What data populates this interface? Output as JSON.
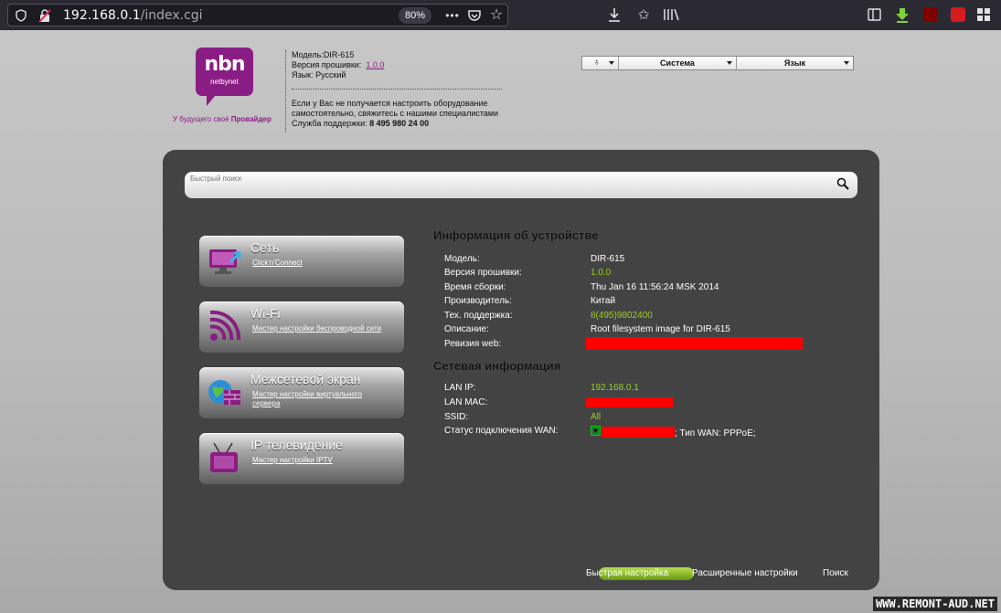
{
  "browser": {
    "url_host": "192.168.0.1",
    "url_path": "/index.cgi",
    "zoom": "80%"
  },
  "header": {
    "logo_top": "nbn",
    "logo_bottom": "netbynet",
    "slogan_prefix": "У будущего своё",
    "slogan_bold": "Провайдер",
    "model_label": "Модель:",
    "model_value": "DIR-615",
    "firmware_label": "Версия прошивки:",
    "firmware_value": "1.0.0",
    "language_label": "Язык:",
    "language_value": "Русский",
    "support_text_1": "Если у Вас не получается настроить оборудование",
    "support_text_2": "самостоятельно, свяжитесь с нашими специалистами",
    "support_label": "Служба поддержки:",
    "support_phone": "8 495 980 24 00"
  },
  "topmenu": {
    "system": "Система",
    "language": "Язык"
  },
  "search": {
    "placeholder": "Быстрый поиск"
  },
  "cards": [
    {
      "title": "Сеть",
      "subtitle": "Click'n'Connect"
    },
    {
      "title": "Wi-Fi",
      "subtitle": "Мастер настройки беспроводной сети"
    },
    {
      "title": "Межсетевой экран",
      "subtitle": "Мастер настройки виртуального сервера"
    },
    {
      "title": "IP телевидение",
      "subtitle": "Мастер настройки IPTV"
    }
  ],
  "device_info": {
    "heading": "Информация об устройстве",
    "rows": [
      {
        "label": "Модель:",
        "value": "DIR-615"
      },
      {
        "label": "Версия прошивки:",
        "value": "1.0.0"
      },
      {
        "label": "Время сборки:",
        "value": "Thu Jan 16 11:56:24 MSK 2014"
      },
      {
        "label": "Производитель:",
        "value": "Китай"
      },
      {
        "label": "Тех. поддержка:",
        "value": "8(495)9802400"
      },
      {
        "label": "Описание:",
        "value": "Root filesystem image for DIR-615"
      },
      {
        "label": "Ревизия web:",
        "value": ""
      }
    ]
  },
  "network_info": {
    "heading": "Сетевая информация",
    "rows": [
      {
        "label": "LAN IP:",
        "value": "192.168.0.1"
      },
      {
        "label": "LAN MAC:",
        "value": ""
      },
      {
        "label": "SSID:",
        "value": "All"
      },
      {
        "label": "Статус подключения WAN:",
        "value": "; Тип WAN: PPPoE;"
      }
    ]
  },
  "bottom_nav": {
    "quick": "Быстрая настройка",
    "advanced": "Расширенные настройки",
    "search": "Поиск"
  },
  "watermark": "WWW.REMONT-AUD.NET",
  "colors": {
    "brand": "#8a1d83",
    "accent_green": "#9ccc2a",
    "panel": "#434343"
  }
}
